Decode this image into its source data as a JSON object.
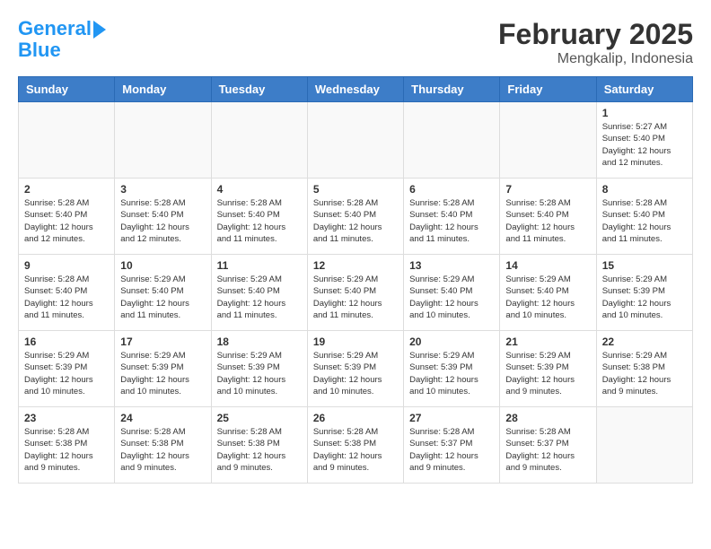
{
  "header": {
    "logo_line1": "General",
    "logo_line2": "Blue",
    "title": "February 2025",
    "subtitle": "Mengkalip, Indonesia"
  },
  "calendar": {
    "days_of_week": [
      "Sunday",
      "Monday",
      "Tuesday",
      "Wednesday",
      "Thursday",
      "Friday",
      "Saturday"
    ],
    "weeks": [
      [
        {
          "day": "",
          "info": ""
        },
        {
          "day": "",
          "info": ""
        },
        {
          "day": "",
          "info": ""
        },
        {
          "day": "",
          "info": ""
        },
        {
          "day": "",
          "info": ""
        },
        {
          "day": "",
          "info": ""
        },
        {
          "day": "1",
          "info": "Sunrise: 5:27 AM\nSunset: 5:40 PM\nDaylight: 12 hours\nand 12 minutes."
        }
      ],
      [
        {
          "day": "2",
          "info": "Sunrise: 5:28 AM\nSunset: 5:40 PM\nDaylight: 12 hours\nand 12 minutes."
        },
        {
          "day": "3",
          "info": "Sunrise: 5:28 AM\nSunset: 5:40 PM\nDaylight: 12 hours\nand 12 minutes."
        },
        {
          "day": "4",
          "info": "Sunrise: 5:28 AM\nSunset: 5:40 PM\nDaylight: 12 hours\nand 11 minutes."
        },
        {
          "day": "5",
          "info": "Sunrise: 5:28 AM\nSunset: 5:40 PM\nDaylight: 12 hours\nand 11 minutes."
        },
        {
          "day": "6",
          "info": "Sunrise: 5:28 AM\nSunset: 5:40 PM\nDaylight: 12 hours\nand 11 minutes."
        },
        {
          "day": "7",
          "info": "Sunrise: 5:28 AM\nSunset: 5:40 PM\nDaylight: 12 hours\nand 11 minutes."
        },
        {
          "day": "8",
          "info": "Sunrise: 5:28 AM\nSunset: 5:40 PM\nDaylight: 12 hours\nand 11 minutes."
        }
      ],
      [
        {
          "day": "9",
          "info": "Sunrise: 5:28 AM\nSunset: 5:40 PM\nDaylight: 12 hours\nand 11 minutes."
        },
        {
          "day": "10",
          "info": "Sunrise: 5:29 AM\nSunset: 5:40 PM\nDaylight: 12 hours\nand 11 minutes."
        },
        {
          "day": "11",
          "info": "Sunrise: 5:29 AM\nSunset: 5:40 PM\nDaylight: 12 hours\nand 11 minutes."
        },
        {
          "day": "12",
          "info": "Sunrise: 5:29 AM\nSunset: 5:40 PM\nDaylight: 12 hours\nand 11 minutes."
        },
        {
          "day": "13",
          "info": "Sunrise: 5:29 AM\nSunset: 5:40 PM\nDaylight: 12 hours\nand 10 minutes."
        },
        {
          "day": "14",
          "info": "Sunrise: 5:29 AM\nSunset: 5:40 PM\nDaylight: 12 hours\nand 10 minutes."
        },
        {
          "day": "15",
          "info": "Sunrise: 5:29 AM\nSunset: 5:39 PM\nDaylight: 12 hours\nand 10 minutes."
        }
      ],
      [
        {
          "day": "16",
          "info": "Sunrise: 5:29 AM\nSunset: 5:39 PM\nDaylight: 12 hours\nand 10 minutes."
        },
        {
          "day": "17",
          "info": "Sunrise: 5:29 AM\nSunset: 5:39 PM\nDaylight: 12 hours\nand 10 minutes."
        },
        {
          "day": "18",
          "info": "Sunrise: 5:29 AM\nSunset: 5:39 PM\nDaylight: 12 hours\nand 10 minutes."
        },
        {
          "day": "19",
          "info": "Sunrise: 5:29 AM\nSunset: 5:39 PM\nDaylight: 12 hours\nand 10 minutes."
        },
        {
          "day": "20",
          "info": "Sunrise: 5:29 AM\nSunset: 5:39 PM\nDaylight: 12 hours\nand 10 minutes."
        },
        {
          "day": "21",
          "info": "Sunrise: 5:29 AM\nSunset: 5:39 PM\nDaylight: 12 hours\nand 9 minutes."
        },
        {
          "day": "22",
          "info": "Sunrise: 5:29 AM\nSunset: 5:38 PM\nDaylight: 12 hours\nand 9 minutes."
        }
      ],
      [
        {
          "day": "23",
          "info": "Sunrise: 5:28 AM\nSunset: 5:38 PM\nDaylight: 12 hours\nand 9 minutes."
        },
        {
          "day": "24",
          "info": "Sunrise: 5:28 AM\nSunset: 5:38 PM\nDaylight: 12 hours\nand 9 minutes."
        },
        {
          "day": "25",
          "info": "Sunrise: 5:28 AM\nSunset: 5:38 PM\nDaylight: 12 hours\nand 9 minutes."
        },
        {
          "day": "26",
          "info": "Sunrise: 5:28 AM\nSunset: 5:38 PM\nDaylight: 12 hours\nand 9 minutes."
        },
        {
          "day": "27",
          "info": "Sunrise: 5:28 AM\nSunset: 5:37 PM\nDaylight: 12 hours\nand 9 minutes."
        },
        {
          "day": "28",
          "info": "Sunrise: 5:28 AM\nSunset: 5:37 PM\nDaylight: 12 hours\nand 9 minutes."
        },
        {
          "day": "",
          "info": ""
        }
      ]
    ]
  }
}
